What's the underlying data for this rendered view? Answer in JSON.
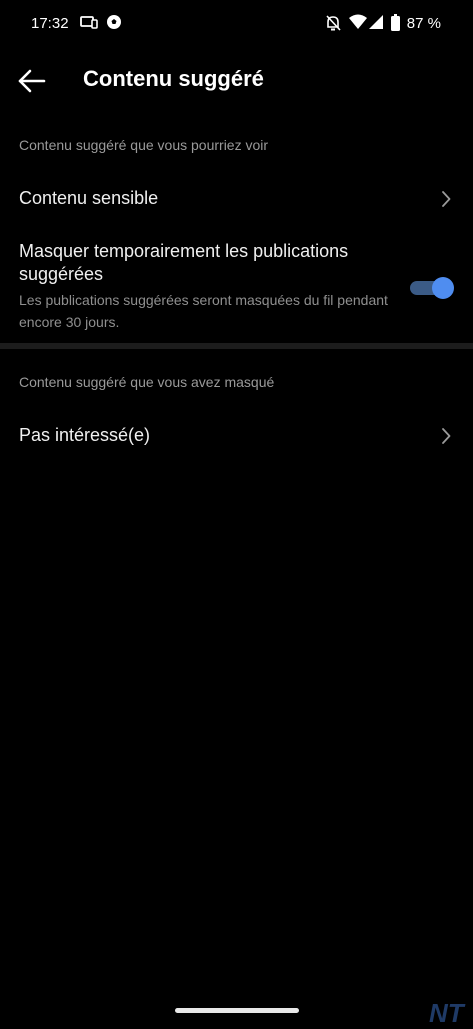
{
  "status_bar": {
    "time": "17:32",
    "battery_percent": "87 %",
    "left_icons": [
      "screen-cast-icon",
      "soccer-ball-icon"
    ],
    "right_icons": [
      "notifications-off-icon",
      "wifi-icon",
      "signal-icon",
      "battery-icon"
    ]
  },
  "header": {
    "title": "Contenu suggéré",
    "back_icon": "arrow-left-icon"
  },
  "sections": [
    {
      "header": "Contenu suggéré que vous pourriez voir",
      "items": [
        {
          "label": "Contenu sensible",
          "type": "link"
        },
        {
          "label": "Masquer temporairement les publications suggérées",
          "sublabel": "Les publications suggérées seront masquées du fil pendant encore 30 jours.",
          "type": "toggle",
          "enabled": true
        }
      ]
    },
    {
      "header": "Contenu suggéré que vous avez masqué",
      "items": [
        {
          "label": "Pas intéressé(e)",
          "type": "link"
        }
      ]
    }
  ],
  "colors": {
    "background": "#000000",
    "toggle_on": "#4f8df0",
    "secondary_text": "#9a9a9a"
  },
  "watermark": "NT"
}
